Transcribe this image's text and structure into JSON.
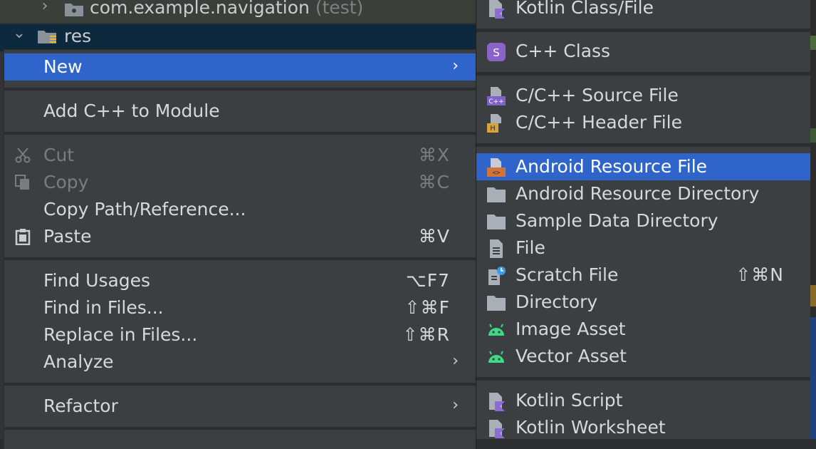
{
  "tree": {
    "row1": {
      "label": "com.example.navigation",
      "suffix": "(test)"
    },
    "row2": {
      "label": "res"
    }
  },
  "menu": {
    "items": [
      {
        "label": "New",
        "shortcut": "",
        "submenu": true,
        "selected": true
      },
      {
        "label": "Add C++ to Module",
        "shortcut": ""
      },
      {
        "label": "Cut",
        "shortcut": "⌘X",
        "icon": "scissors-icon",
        "disabled": true
      },
      {
        "label": "Copy",
        "shortcut": "⌘C",
        "icon": "copy-icon",
        "disabled": true
      },
      {
        "label": "Copy Path/Reference...",
        "shortcut": ""
      },
      {
        "label": "Paste",
        "shortcut": "⌘V",
        "icon": "clipboard-icon"
      },
      {
        "label": "Find Usages",
        "shortcut": "⌥F7"
      },
      {
        "label": "Find in Files...",
        "shortcut": "⇧⌘F"
      },
      {
        "label": "Replace in Files...",
        "shortcut": "⇧⌘R"
      },
      {
        "label": "Analyze",
        "shortcut": "",
        "submenu": true
      },
      {
        "label": "Refactor",
        "shortcut": "",
        "submenu": true
      }
    ]
  },
  "submenu": {
    "items": [
      {
        "label": "Kotlin Class/File",
        "icon": "kotlin-file-icon"
      },
      {
        "label": "C++ Class",
        "icon": "cpp-class-icon"
      },
      {
        "label": "C/C++ Source File",
        "icon": "cpp-source-icon"
      },
      {
        "label": "C/C++ Header File",
        "icon": "cpp-header-icon"
      },
      {
        "label": "Android Resource File",
        "icon": "resource-file-icon",
        "selected": true
      },
      {
        "label": "Android Resource Directory",
        "icon": "folder-icon"
      },
      {
        "label": "Sample Data Directory",
        "icon": "folder-icon"
      },
      {
        "label": "File",
        "icon": "file-icon"
      },
      {
        "label": "Scratch File",
        "icon": "scratch-file-icon",
        "shortcut": "⇧⌘N"
      },
      {
        "label": "Directory",
        "icon": "folder-icon"
      },
      {
        "label": "Image Asset",
        "icon": "android-icon"
      },
      {
        "label": "Vector Asset",
        "icon": "android-icon"
      },
      {
        "label": "Kotlin Script",
        "icon": "kotlin-script-icon"
      },
      {
        "label": "Kotlin Worksheet",
        "icon": "kotlin-worksheet-icon"
      }
    ]
  },
  "colors": {
    "selection": "#2f65ca",
    "menu_bg": "#3c3f41",
    "text": "#d5d8dc",
    "disabled_text": "#7a7d80",
    "android_green": "#3ddc84",
    "kotlin_purple": "#8f6bd6"
  },
  "submenu_arrow": "›",
  "tree_arrows": {
    "collapsed": "›",
    "expanded": "⌄"
  }
}
